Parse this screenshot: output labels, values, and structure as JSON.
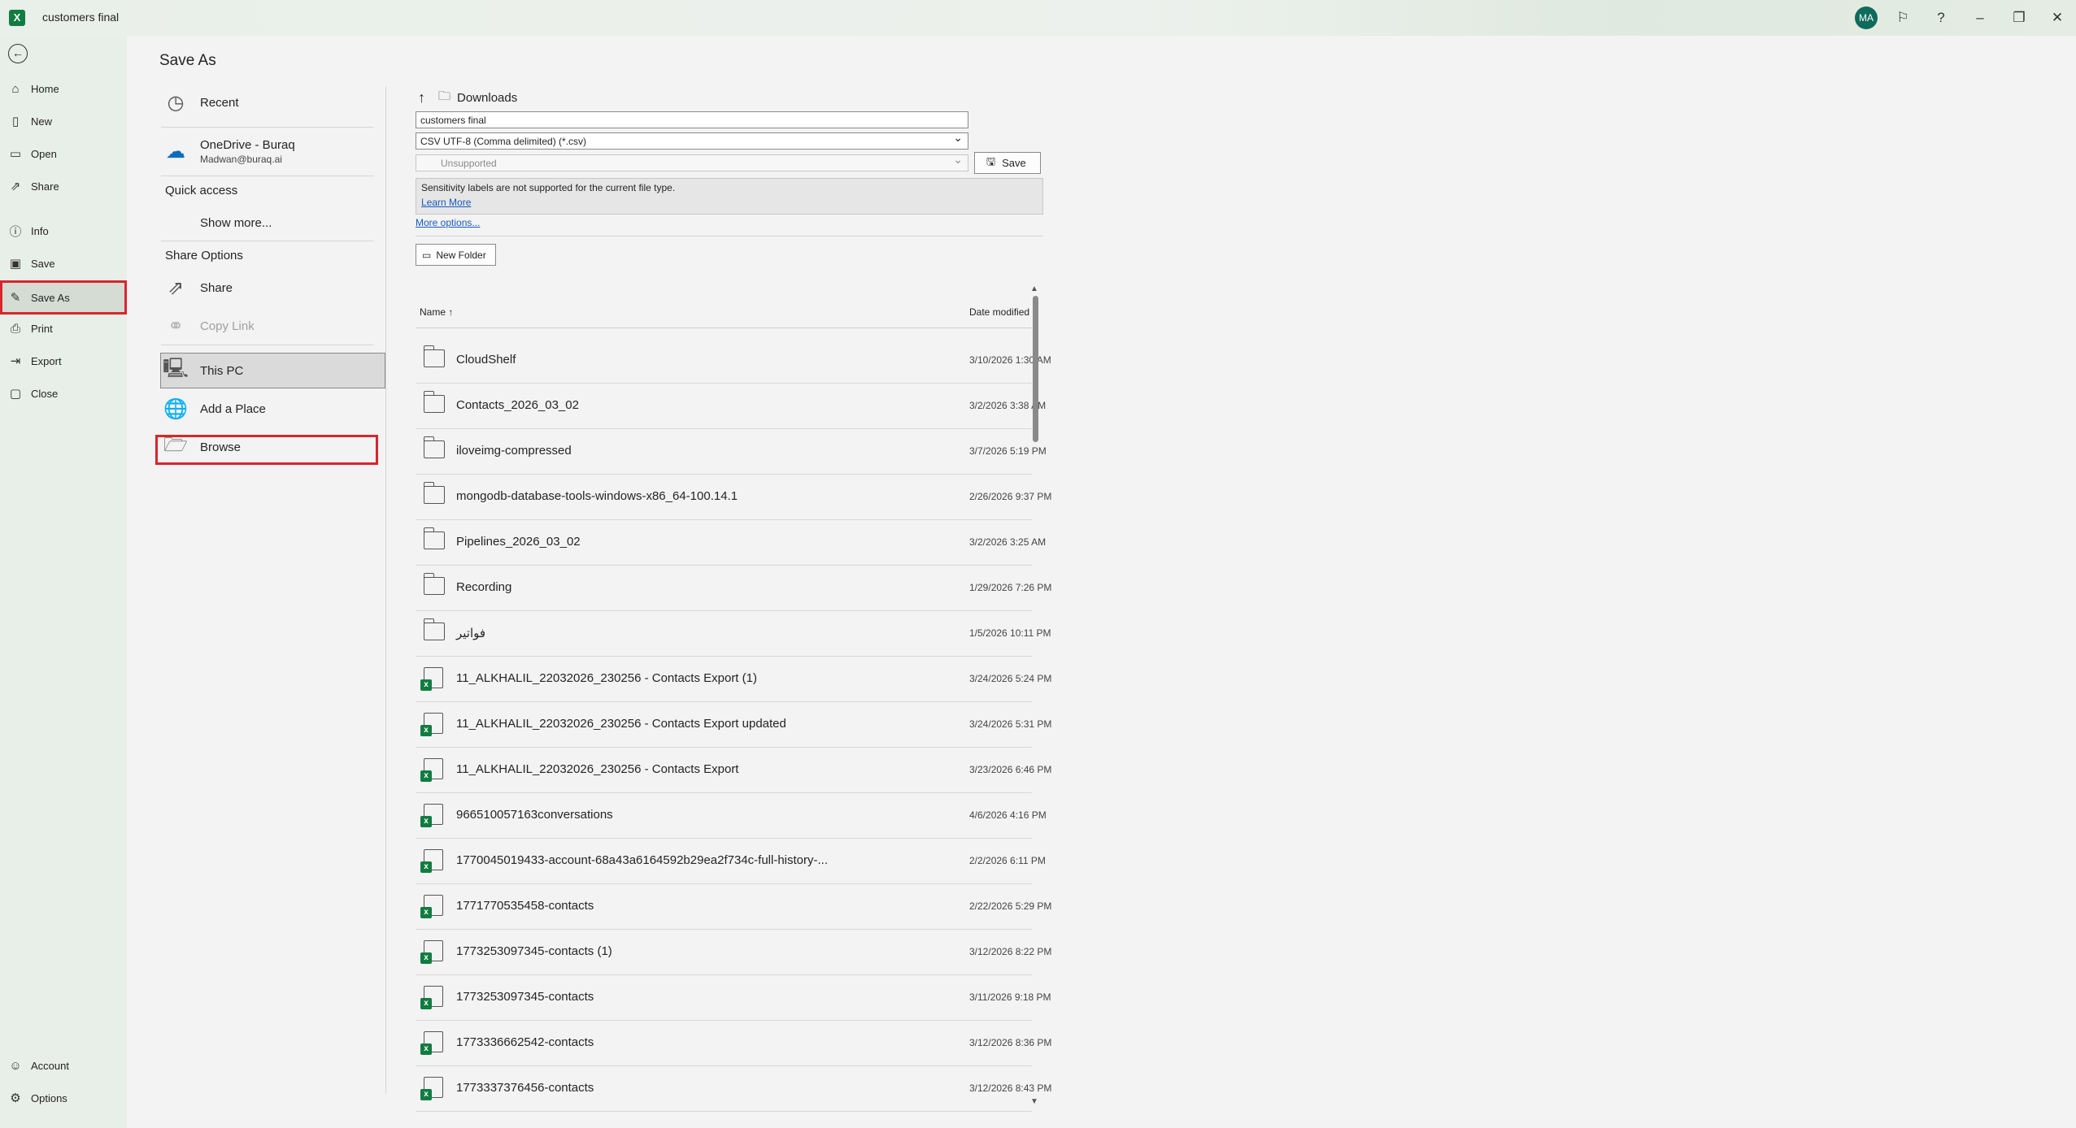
{
  "titlebar": {
    "app_icon": "excel-icon",
    "doc_title": "customers final",
    "avatar_initials": "MA",
    "icons": [
      "feedback-icon",
      "help-icon",
      "minimize-icon",
      "restore-icon",
      "close-icon"
    ],
    "help_glyph": "?"
  },
  "nav": {
    "items": [
      {
        "label": "Home",
        "icon": "home-icon"
      },
      {
        "label": "New",
        "icon": "new-icon"
      },
      {
        "label": "Open",
        "icon": "open-icon"
      },
      {
        "label": "Share",
        "icon": "share-icon"
      },
      {
        "label": "Info",
        "icon": "info-icon"
      },
      {
        "label": "Save",
        "icon": "save-icon"
      },
      {
        "label": "Save As",
        "icon": "save-as-icon"
      },
      {
        "label": "Print",
        "icon": "print-icon"
      },
      {
        "label": "Export",
        "icon": "export-icon"
      },
      {
        "label": "Close",
        "icon": "close-doc-icon"
      },
      {
        "label": "Account",
        "icon": "account-icon"
      },
      {
        "label": "Options",
        "icon": "options-icon"
      }
    ],
    "selected": "Save As"
  },
  "page_title": "Save As",
  "places": {
    "recent": "Recent",
    "onedrive_name": "OneDrive - Buraq",
    "onedrive_email": "Madwan@buraq.ai",
    "quick_access": "Quick access",
    "show_more": "Show more...",
    "share_options": "Share Options",
    "share": "Share",
    "copy_link": "Copy Link",
    "this_pc": "This PC",
    "add_place": "Add a Place",
    "browse": "Browse"
  },
  "save_panel": {
    "location": "Downloads",
    "file_name": "customers final",
    "file_type": "CSV UTF-8 (Comma delimited) (*.csv)",
    "sensitivity": "Unsupported",
    "save_label": "Save",
    "sensitivity_msg": "Sensitivity labels are not supported for the current file type.",
    "learn_more": "Learn More",
    "more_options": "More options...",
    "new_folder": "New Folder"
  },
  "file_list": {
    "col_name": "Name",
    "sort_glyph": "↑",
    "col_date": "Date modified",
    "rows": [
      {
        "type": "folder",
        "name": "CloudShelf",
        "date": "3/10/2026 1:30 AM"
      },
      {
        "type": "folder",
        "name": "Contacts_2026_03_02",
        "date": "3/2/2026 3:38 AM"
      },
      {
        "type": "folder",
        "name": "iloveimg-compressed",
        "date": "3/7/2026 5:19 PM"
      },
      {
        "type": "folder",
        "name": "mongodb-database-tools-windows-x86_64-100.14.1",
        "date": "2/26/2026 9:37 PM"
      },
      {
        "type": "folder",
        "name": "Pipelines_2026_03_02",
        "date": "3/2/2026 3:25 AM"
      },
      {
        "type": "folder",
        "name": "Recording",
        "date": "1/29/2026 7:26 PM"
      },
      {
        "type": "folder",
        "name": "فواتير",
        "date": "1/5/2026 10:11 PM"
      },
      {
        "type": "excel",
        "name": "11_ALKHALIL_22032026_230256 - Contacts Export (1)",
        "date": "3/24/2026 5:24 PM"
      },
      {
        "type": "excel",
        "name": "11_ALKHALIL_22032026_230256 - Contacts Export updated",
        "date": "3/24/2026 5:31 PM"
      },
      {
        "type": "excel",
        "name": "11_ALKHALIL_22032026_230256 - Contacts Export",
        "date": "3/23/2026 6:46 PM"
      },
      {
        "type": "excel",
        "name": "966510057163conversations",
        "date": "4/6/2026 4:16 PM"
      },
      {
        "type": "excel",
        "name": "1770045019433-account-68a43a6164592b29ea2f734c-full-history-...",
        "date": "2/2/2026 6:11 PM"
      },
      {
        "type": "excel",
        "name": "1771770535458-contacts",
        "date": "2/22/2026 5:29 PM"
      },
      {
        "type": "excel",
        "name": "1773253097345-contacts (1)",
        "date": "3/12/2026 8:22 PM"
      },
      {
        "type": "excel",
        "name": "1773253097345-contacts",
        "date": "3/11/2026 9:18 PM"
      },
      {
        "type": "excel",
        "name": "1773336662542-contacts",
        "date": "3/12/2026 8:36 PM"
      },
      {
        "type": "excel",
        "name": "1773337376456-contacts",
        "date": "3/12/2026 8:43 PM"
      }
    ]
  },
  "colors": {
    "highlight": "#d9252b",
    "excel_green": "#107c41",
    "link": "#185abd"
  }
}
